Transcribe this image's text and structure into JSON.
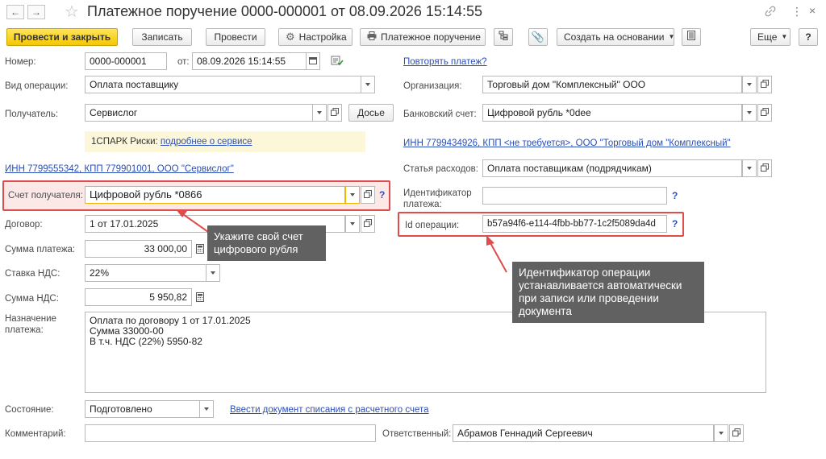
{
  "window": {
    "title": "Платежное поручение 0000-000001 от 08.09.2026 15:14:55"
  },
  "toolbar": {
    "post_and_close": "Провести и закрыть",
    "save": "Записать",
    "post": "Провести",
    "settings": "Настройка",
    "print_payment_order": "Платежное поручение",
    "create_based_on": "Создать на основании",
    "more": "Еще",
    "help": "?"
  },
  "form": {
    "number_label": "Номер:",
    "number_value": "0000-000001",
    "date_label": "от:",
    "date_value": "08.09.2026 15:14:55",
    "repeat_link": "Повторять платеж?",
    "operation_label": "Вид операции:",
    "operation_value": "Оплата поставщику",
    "organization_label": "Организация:",
    "organization_value": "Торговый дом \"Комплексный\" ООО",
    "recipient_label": "Получатель:",
    "recipient_value": "Сервислог",
    "dossier_button": "Досье",
    "bank_account_label": "Банковский счет:",
    "bank_account_value": "Цифровой рубль *0dee",
    "spark_text": "1СПАРК Риски:",
    "spark_link": "подробнее о сервисе",
    "org_inn_link": "ИНН 7799434926, КПП <не требуется>, ООО \"Торговый дом \"Комплексный\"",
    "recipient_inn_link": "ИНН 7799555342, КПП 779901001, ООО \"Сервислог\"",
    "expense_label": "Статья расходов:",
    "expense_value": "Оплата поставщикам (подрядчикам)",
    "recipient_account_label": "Счет получателя:",
    "recipient_account_value": "Цифровой рубль *0866",
    "payment_id_label": "Идентификатор платежа:",
    "payment_id_value": "",
    "contract_label": "Договор:",
    "contract_value": "1 от 17.01.2025",
    "operation_id_label": "Id операции:",
    "operation_id_value": "b57a94f6-e114-4fbb-bb77-1c2f5089da4d",
    "amount_label": "Сумма платежа:",
    "amount_value": "33 000,00",
    "vat_rate_label": "Ставка НДС:",
    "vat_rate_value": "22%",
    "vat_amount_label": "Сумма НДС:",
    "vat_amount_value": "5 950,82",
    "purpose_label": "Назначение платежа:",
    "purpose_lines": [
      "Оплата по договору 1 от 17.01.2025",
      "Сумма 33000-00",
      "В т.ч. НДС  (22%) 5950-82"
    ],
    "state_label": "Состояние:",
    "state_value": "Подготовлено",
    "enter_writeoff_link": "Ввести документ списания с расчетного счета",
    "comment_label": "Комментарий:",
    "comment_value": "",
    "responsible_label": "Ответственный:",
    "responsible_value": "Абрамов Геннадий Сергеевич"
  },
  "callouts": {
    "account_hint": "Укажите свой счет цифрового рубля",
    "operation_id_hint": "Идентификатор операции устанавливается автоматически при записи или проведении документа"
  },
  "colors": {
    "primary_button": "#f5c800",
    "link": "#2a4fb8",
    "highlight_border": "#e04b4b",
    "callout_bg": "#616161"
  }
}
